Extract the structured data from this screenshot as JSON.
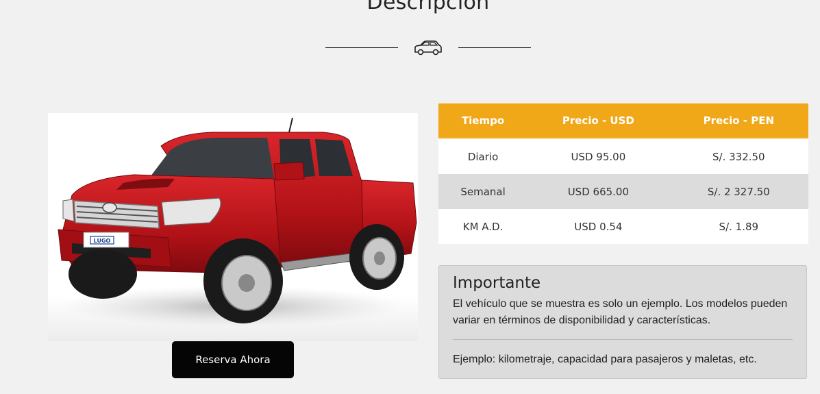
{
  "section": {
    "title": "Descripción"
  },
  "icons": {
    "divider_icon": "car-icon"
  },
  "actions": {
    "reserve_label": "Reserva Ahora"
  },
  "pricing": {
    "headers": [
      "Tiempo",
      "Precio - USD",
      "Precio - PEN"
    ],
    "rows": [
      {
        "period": "Diario",
        "usd": "USD 95.00",
        "pen": "S/. 332.50"
      },
      {
        "period": "Semanal",
        "usd": "USD 665.00",
        "pen": "S/. 2 327.50"
      },
      {
        "period": "KM A.D.",
        "usd": "USD 0.54",
        "pen": "S/. 1.89"
      }
    ]
  },
  "important": {
    "title": "Importante",
    "text": "El vehículo que se muestra es solo un ejemplo. Los modelos pueden variar en términos de disponibilidad y características.",
    "example": "Ejemplo: kilometraje, capacidad para pasajeros y maletas, etc."
  },
  "vehicle_image": {
    "plate_text": "LUGO"
  },
  "colors": {
    "accent": "#f0a818",
    "button_bg": "#050505",
    "page_bg": "#f1f1f1",
    "stripe": "#dcdcdc",
    "vehicle_body": "#c0151b"
  }
}
